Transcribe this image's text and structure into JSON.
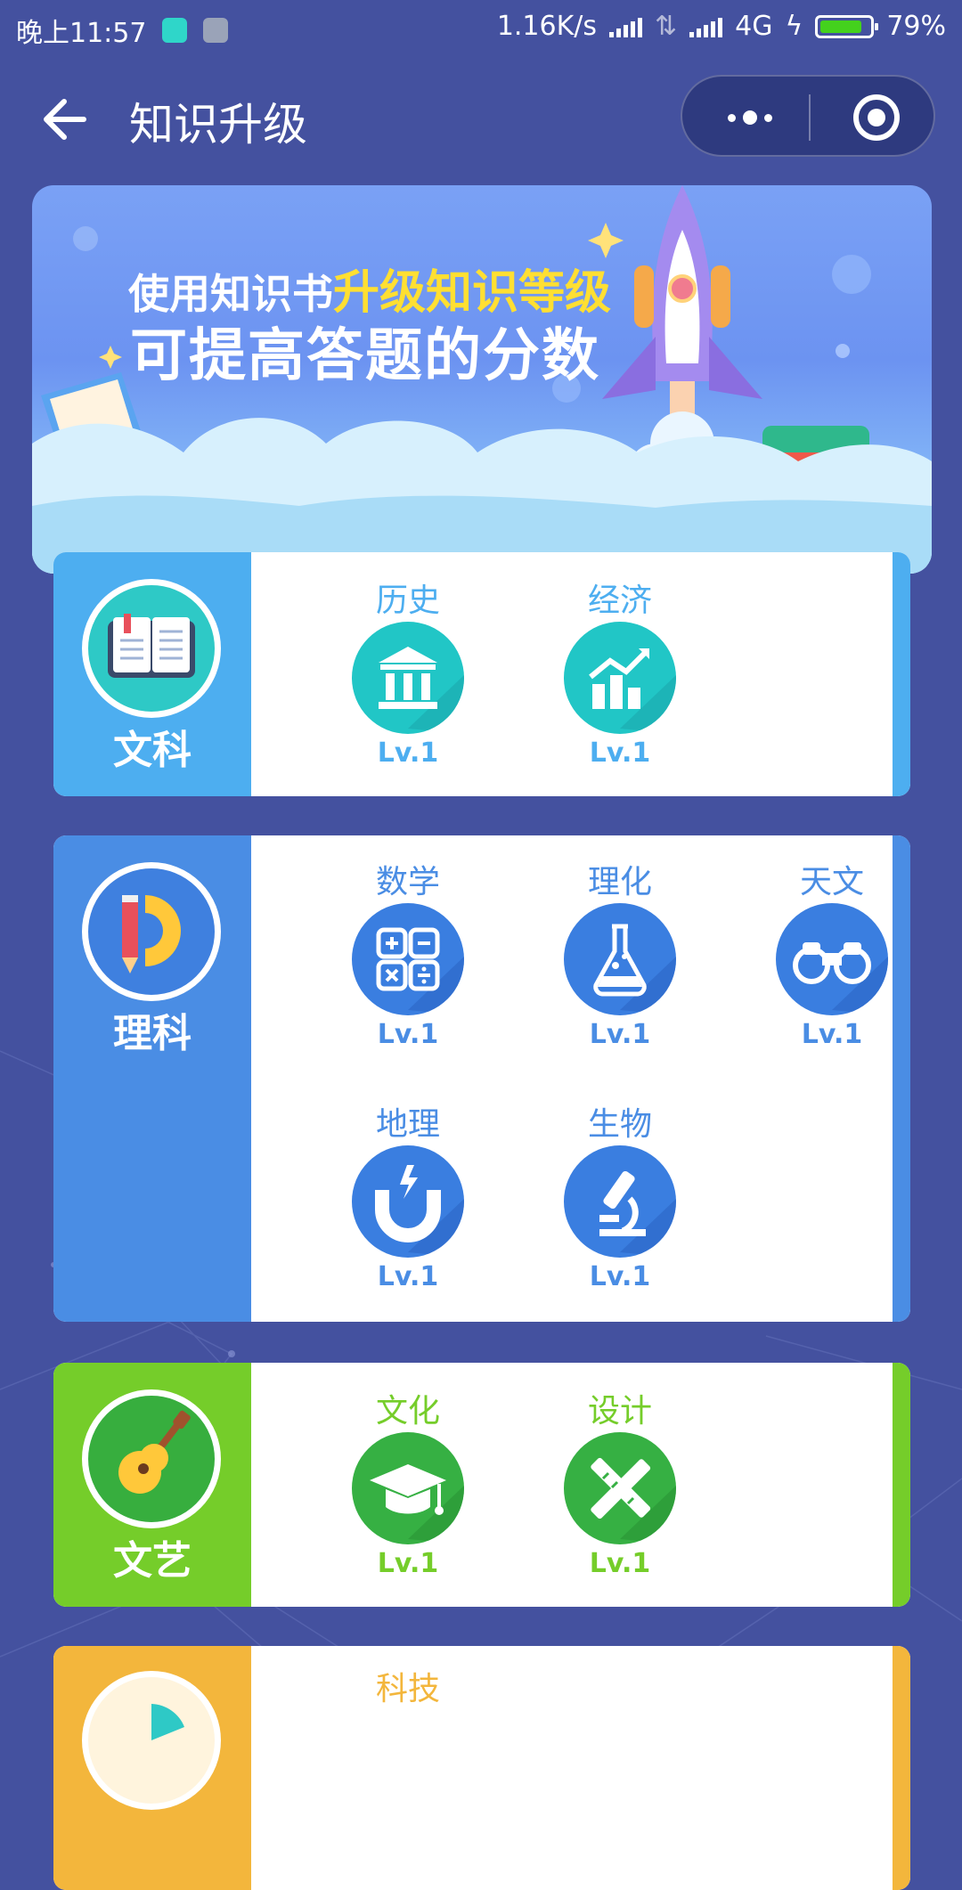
{
  "status_bar": {
    "time": "晚上11:57",
    "speed": "1.16K/s",
    "network": "4G",
    "battery": "79%"
  },
  "nav": {
    "title": "知识升级"
  },
  "banner": {
    "line1_prefix": "使用知识书",
    "line1_highlight": "升级知识等级",
    "line2": "可提高答题的分数"
  },
  "colors": {
    "background": "#44519f",
    "wenke": "#4daef0",
    "like": "#4a8de4",
    "wenyi": "#75cd2a",
    "keji": "#f3b63c"
  },
  "categories": [
    {
      "label": "文科",
      "icon": "open-book-icon",
      "subjects": [
        {
          "name": "历史",
          "icon": "museum-icon",
          "level": "Lv.1"
        },
        {
          "name": "经济",
          "icon": "growth-chart-icon",
          "level": "Lv.1"
        }
      ]
    },
    {
      "label": "理科",
      "icon": "pencil-protractor-icon",
      "subjects": [
        {
          "name": "数学",
          "icon": "calculator-icon",
          "level": "Lv.1"
        },
        {
          "name": "理化",
          "icon": "flask-icon",
          "level": "Lv.1"
        },
        {
          "name": "天文",
          "icon": "binoculars-icon",
          "level": "Lv.1"
        },
        {
          "name": "地理",
          "icon": "magnet-icon",
          "level": "Lv.1"
        },
        {
          "name": "生物",
          "icon": "microscope-icon",
          "level": "Lv.1"
        }
      ]
    },
    {
      "label": "文艺",
      "icon": "guitar-icon",
      "subjects": [
        {
          "name": "文化",
          "icon": "graduation-cap-icon",
          "level": "Lv.1"
        },
        {
          "name": "设计",
          "icon": "pencil-ruler-icon",
          "level": "Lv.1"
        }
      ]
    },
    {
      "label": "",
      "icon": "pie-chart-icon",
      "subjects": [
        {
          "name": "科技",
          "icon": "tech-icon",
          "level": ""
        }
      ]
    }
  ]
}
